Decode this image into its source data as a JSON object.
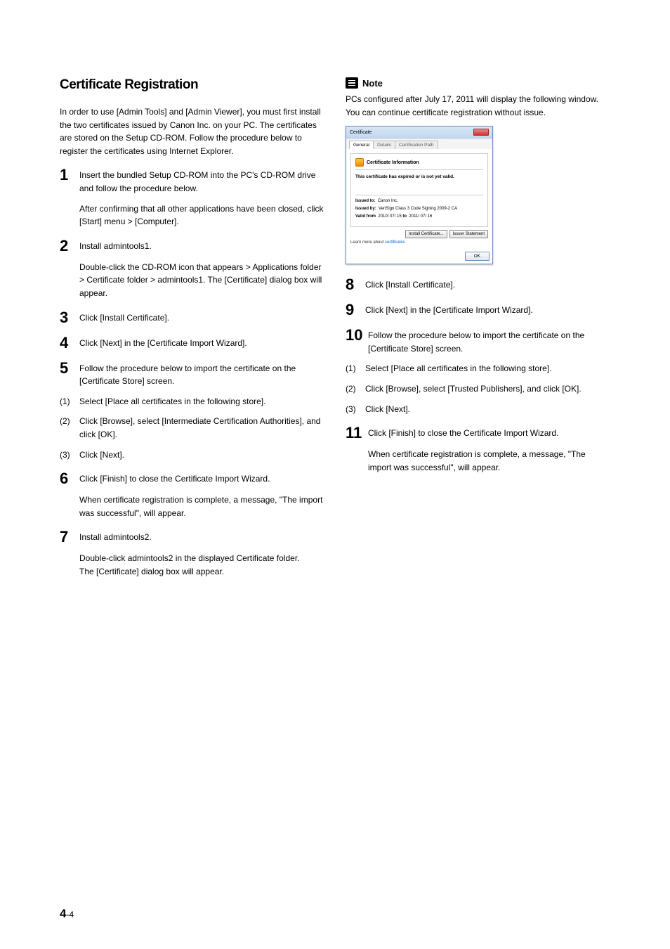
{
  "heading": "Certificate Registration",
  "intro": "In order to use [Admin Tools] and [Admin Viewer], you must first install the two certificates issued by Canon Inc. on your PC. The certificates are stored on the Setup CD-ROM. Follow the procedure below to register the certificates using Internet Explorer.",
  "steps": {
    "s1": "Insert the bundled Setup CD-ROM into the PC's CD-ROM drive and follow the procedure below.",
    "s1_sub": "After confirming that all other applications have been closed, click [Start] menu > [Computer].",
    "s2": "Install admintools1.",
    "s2_sub": "Double-click the CD-ROM icon that appears > Applications folder > Certificate folder > admintools1. The [Certificate] dialog box will appear.",
    "s3": "Click [Install Certificate].",
    "s4": "Click [Next] in the [Certificate Import Wizard].",
    "s5": "Follow the procedure below to import the certificate on the [Certificate Store] screen.",
    "s6": "Click [Finish] to close the Certificate Import Wizard.",
    "s6_sub": "When certificate registration is complete, a message, \"The import was successful\", will appear.",
    "s7": "Install admintools2.",
    "s7_sub": "Double-click admintools2 in the displayed Certificate folder.\nThe [Certificate] dialog box will appear.",
    "s8": "Click [Install Certificate].",
    "s9": "Click [Next] in the [Certificate Import Wizard].",
    "s10": "Follow the procedure below to import the certificate on the [Certificate Store] screen.",
    "s11": "Click [Finish] to close the Certificate Import Wizard.",
    "s11_sub": "When certificate registration is complete, a message, \"The import was successful\", will appear."
  },
  "sub5": {
    "a": "Select [Place all certificates in the following store].",
    "b": "Click [Browse], select [Intermediate Certification Authorities], and click [OK].",
    "c": "Click [Next]."
  },
  "sub10": {
    "a": "Select [Place all certificates in the following store].",
    "b": "Click [Browse], select [Trusted Publishers], and click [OK].",
    "c": "Click [Next]."
  },
  "note": {
    "label": "Note",
    "text": "PCs configured after July 17, 2011 will display the following window. You can continue certificate registration without issue."
  },
  "dialog": {
    "title": "Certificate",
    "tabs": {
      "general": "General",
      "details": "Details",
      "path": "Certification Path"
    },
    "info_title": "Certificate Information",
    "msg": "This certificate has expired or is not yet valid.",
    "issued_to_label": "Issued to:",
    "issued_to": "Canon Inc.",
    "issued_by_label": "Issued by:",
    "issued_by": "VeriSign Class 3 Code Signing 2009-2 CA",
    "valid_label": "Valid from",
    "valid_from": "2010/ 07/ 15",
    "valid_to_label": "to",
    "valid_to": "2011/ 07/ 16",
    "install_btn": "Install Certificate...",
    "issuer_btn": "Issuer Statement",
    "learn_prefix": "Learn more about ",
    "learn_link": "certificates",
    "ok": "OK"
  },
  "footer": {
    "chapter": "4",
    "page": "-4"
  }
}
